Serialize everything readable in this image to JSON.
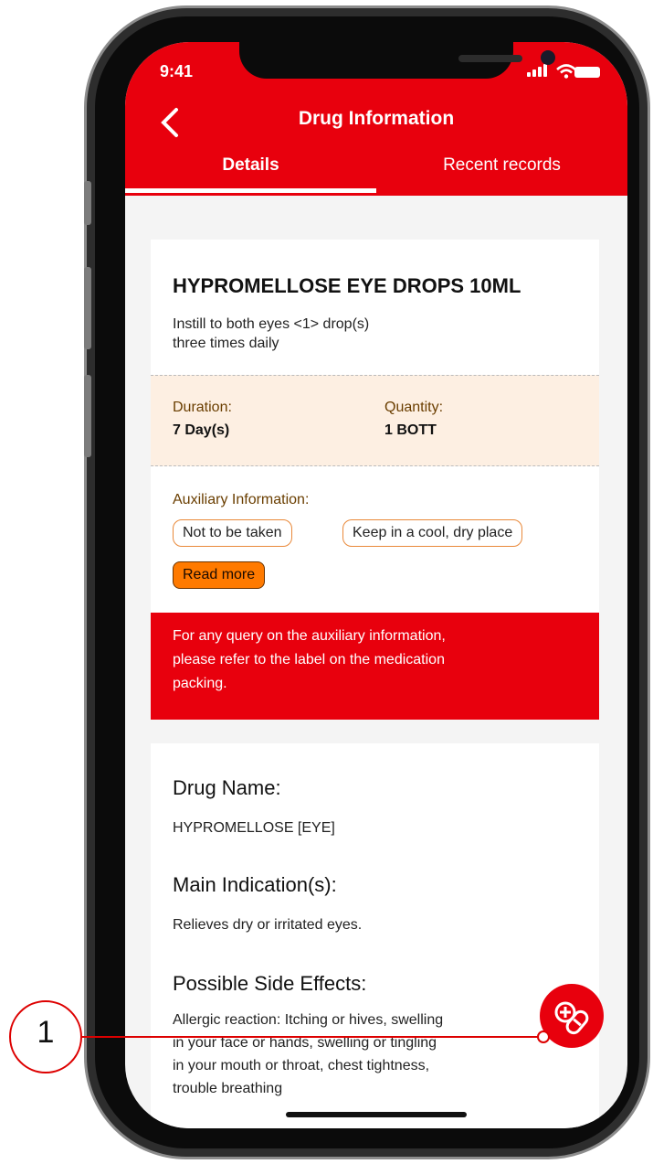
{
  "status_bar": {
    "time": "9:41"
  },
  "header": {
    "title": "Drug Information",
    "tabs": [
      {
        "label": "Details"
      },
      {
        "label": "Recent records"
      }
    ]
  },
  "prescription": {
    "drug_title": "HYPROMELLOSE EYE DROPS 10ML",
    "dosage_line1": "Instill to both eyes <1> drop(s)",
    "dosage_line2": "three times daily",
    "duration_label": "Duration:",
    "duration_value": "7 Day(s)",
    "quantity_label": "Quantity:",
    "quantity_value": "1 BOTT",
    "aux_label": "Auxiliary Information:",
    "aux_chips": [
      "Not to be taken",
      "Keep in a cool, dry place"
    ],
    "read_more": "Read more",
    "notice_line1": "For any query on the auxiliary information,",
    "notice_line2": "please refer to the label on the medication",
    "notice_line3": "packing."
  },
  "details": {
    "drug_name_heading": "Drug Name:",
    "drug_name": "HYPROMELLOSE [EYE]",
    "indication_heading": "Main Indication(s):",
    "indication": "Relieves dry or irritated eyes.",
    "side_effects_heading": "Possible Side Effects:",
    "side_effects_line1": "Allergic reaction: Itching or hives, swelling",
    "side_effects_line2": "in your face or hands, swelling or tingling",
    "side_effects_line3": "in your mouth or throat, chest tightness,",
    "side_effects_line4": "trouble breathing"
  },
  "fab": {
    "icon": "pill-plus-icon"
  },
  "callout": {
    "number": "1"
  },
  "colors": {
    "brand_red": "#e8000d",
    "accent_orange": "#ff7a00",
    "band_peach": "#fdefe2"
  }
}
